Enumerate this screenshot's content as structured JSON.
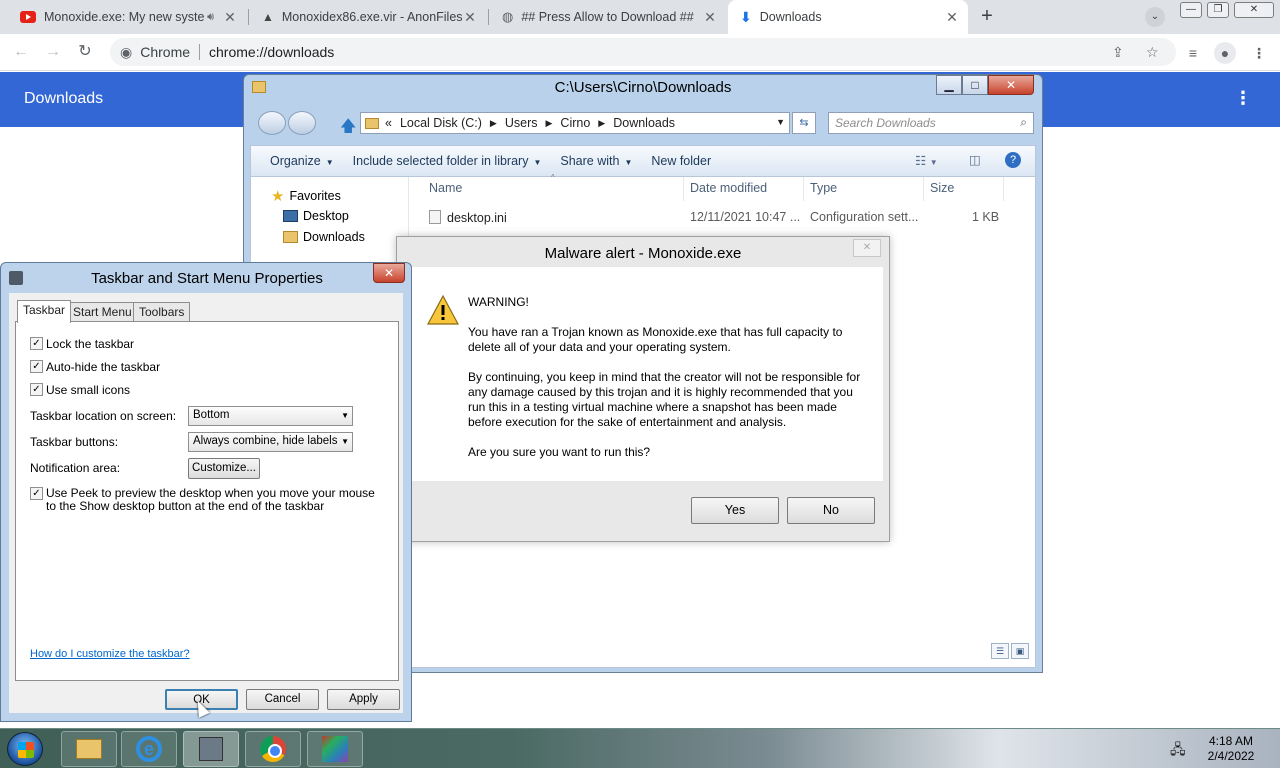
{
  "browser": {
    "tabs": [
      {
        "label": "Monoxide.exe: My new syste",
        "icon": "youtube-icon"
      },
      {
        "label": "Monoxidex86.exe.vir - AnonFiles",
        "icon": "anonfiles-icon"
      },
      {
        "label": "## Press Allow to Download ##",
        "icon": "globe-icon"
      },
      {
        "label": "Downloads",
        "icon": "download-icon"
      }
    ],
    "omnibox": {
      "chip": "Chrome",
      "url": "chrome://downloads"
    },
    "page_title": "Downloads",
    "accent": "#3367d6"
  },
  "explorer": {
    "title": "C:\\Users\\Cirno\\Downloads",
    "breadcrumb": [
      "Local Disk (C:)",
      "Users",
      "Cirno",
      "Downloads"
    ],
    "search_placeholder": "Search Downloads",
    "commands": [
      "Organize",
      "Include selected folder in library",
      "Share with",
      "New folder"
    ],
    "nav": {
      "favorites": "Favorites",
      "desktop": "Desktop",
      "downloads": "Downloads"
    },
    "columns": {
      "name": "Name",
      "date": "Date modified",
      "type": "Type",
      "size": "Size"
    },
    "files": [
      {
        "name": "desktop.ini",
        "date": "12/11/2021 10:47 ...",
        "type": "Configuration sett...",
        "size": "1 KB"
      }
    ]
  },
  "alert": {
    "title": "Malware alert - Monoxide.exe",
    "heading": "WARNING!",
    "para1": "You have ran a Trojan known as Monoxide.exe that has full capacity to delete all of your data and your operating system.",
    "para2": "By continuing, you keep in mind that the creator will not be responsible for any damage caused by this trojan and it is highly recommended that you run this in a testing virtual machine where a snapshot has been made before execution for the sake of entertainment and analysis.",
    "question": "Are you sure you want to run this?",
    "yes": "Yes",
    "no": "No"
  },
  "taskbar_props": {
    "title": "Taskbar and Start Menu Properties",
    "tabs": [
      "Taskbar",
      "Start Menu",
      "Toolbars"
    ],
    "checks": {
      "lock": {
        "label": "Lock the taskbar",
        "checked": true
      },
      "autohide": {
        "label": "Auto-hide the taskbar",
        "checked": true
      },
      "small_icons": {
        "label": "Use small icons",
        "checked": true
      },
      "peek": {
        "label": "Use Peek to preview the desktop when you move your mouse to the Show desktop button at the end of the taskbar",
        "checked": true
      }
    },
    "location_label": "Taskbar location on screen:",
    "location_value": "Bottom",
    "buttons_label": "Taskbar buttons:",
    "buttons_value": "Always combine, hide labels",
    "notif_label": "Notification area:",
    "customize": "Customize...",
    "help_link": "How do I customize the taskbar?",
    "ok": "OK",
    "cancel": "Cancel",
    "apply": "Apply"
  },
  "system_tray": {
    "time": "4:18 AM",
    "date": "2/4/2022"
  }
}
